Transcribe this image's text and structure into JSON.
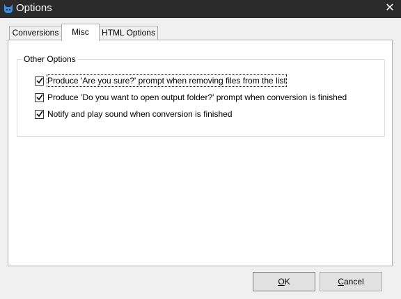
{
  "window": {
    "title": "Options",
    "close_glyph": "✕",
    "icon": "cat-app-icon"
  },
  "tabs": [
    {
      "label": "Conversions",
      "active": false
    },
    {
      "label": "Misc",
      "active": true
    },
    {
      "label": "HTML Options",
      "active": false
    }
  ],
  "group": {
    "label": "Other Options",
    "options": [
      {
        "label": "Produce 'Are you sure?' prompt when removing files from the list",
        "checked": true
      },
      {
        "label": "Produce 'Do you want to open output folder?' prompt when conversion is finished",
        "checked": true
      },
      {
        "label": "Notify and play sound when conversion is finished",
        "checked": true
      }
    ]
  },
  "buttons": {
    "ok": {
      "mnemonic": "O",
      "rest": "K"
    },
    "cancel": {
      "mnemonic": "C",
      "rest": "ancel"
    }
  },
  "colors": {
    "titlebar": "#2b2b2b",
    "dialog_bg": "#f0f0f0",
    "accent_icon": "#3c8de0"
  }
}
